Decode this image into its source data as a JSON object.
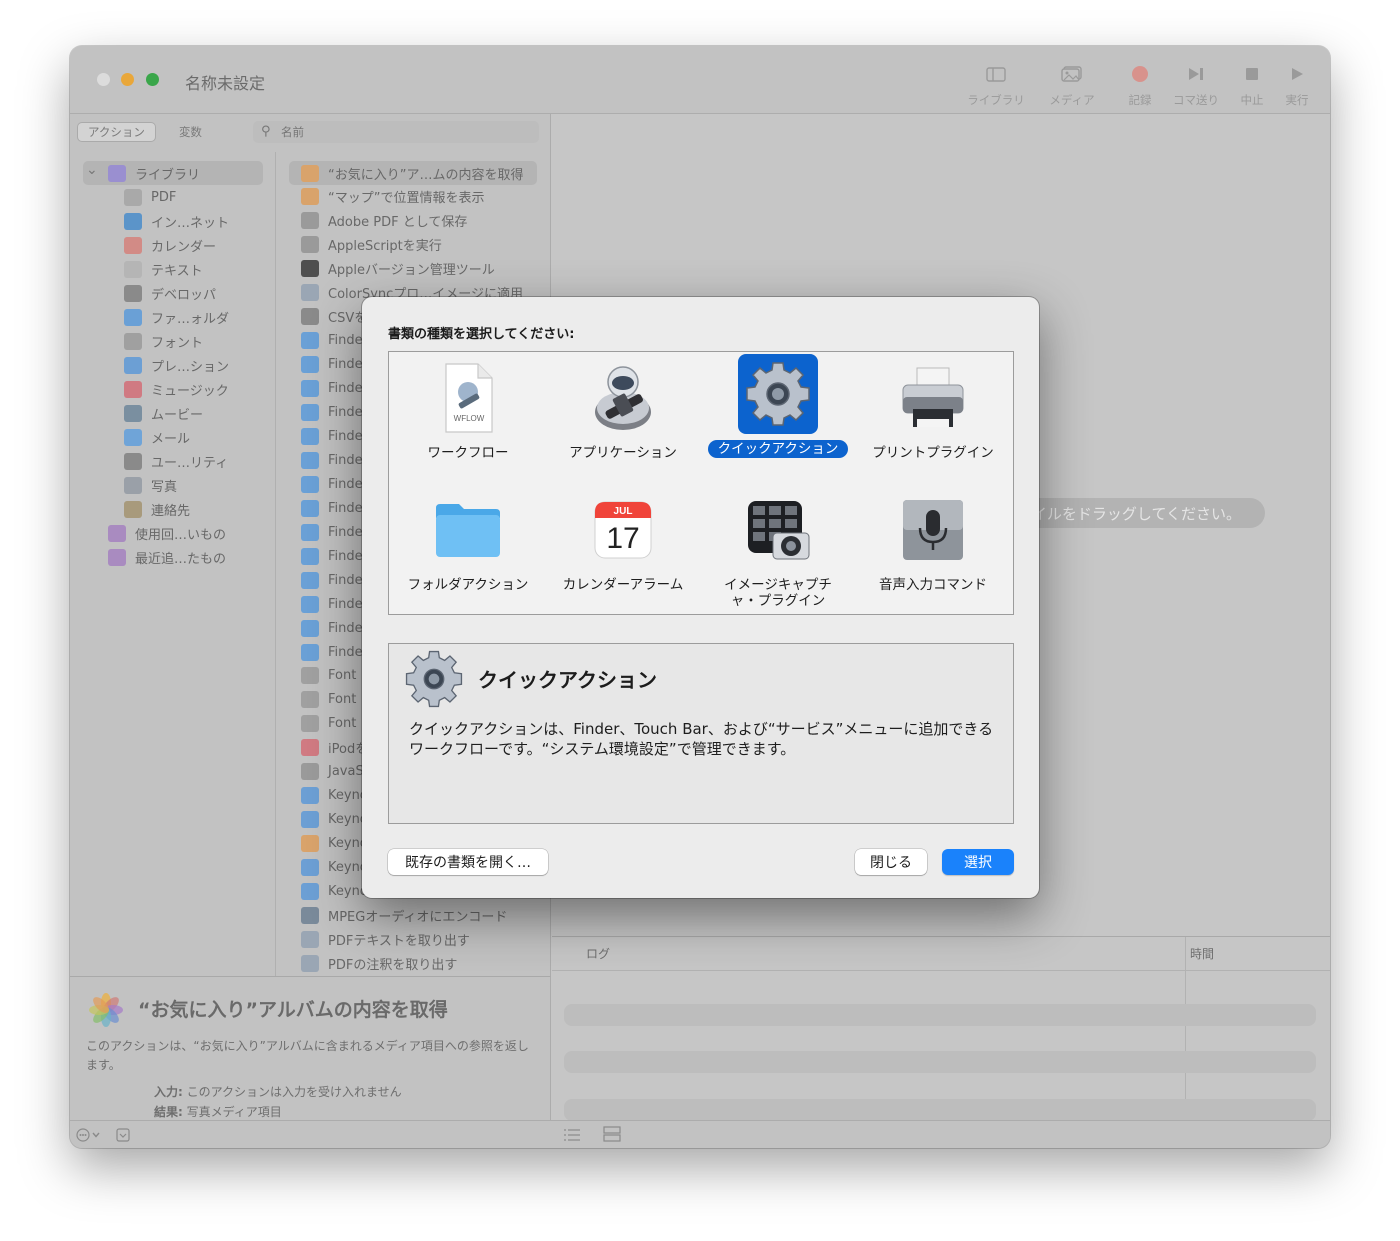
{
  "window": {
    "title": "名称未設定"
  },
  "colors": {
    "accent": "#0c63ce",
    "primary_button": "#1a82fb",
    "close": "#ff5f57",
    "minimize": "#febc2e",
    "zoom": "#28c840"
  },
  "toolbar": {
    "library": "ライブラリ",
    "media": "メディア",
    "record": "記録",
    "step": "コマ送り",
    "stop": "中止",
    "run": "実行"
  },
  "sidebar": {
    "tabs": {
      "actions": "アクション",
      "variables": "変数"
    },
    "search_placeholder": "名前",
    "library": [
      {
        "label": "ライブラリ",
        "icon": "library-icon",
        "color": "#9a8fd0"
      },
      {
        "label": "PDF",
        "icon": "pdf-icon",
        "color": "#a9a9a9"
      },
      {
        "label": "イン…ネット",
        "icon": "globe-icon",
        "color": "#5b94c9"
      },
      {
        "label": "カレンダー",
        "icon": "calendar-icon",
        "color": "#d28b86"
      },
      {
        "label": "テキスト",
        "icon": "text-icon",
        "color": "#b5b5b5"
      },
      {
        "label": "デベロッパ",
        "icon": "tools-icon",
        "color": "#8a8a8a"
      },
      {
        "label": "ファ…ォルダ",
        "icon": "finder-icon",
        "color": "#6aa0d6"
      },
      {
        "label": "フォント",
        "icon": "font-icon",
        "color": "#a0a0a0"
      },
      {
        "label": "プレ…ション",
        "icon": "keynote-icon",
        "color": "#6c9fd4"
      },
      {
        "label": "ミュージック",
        "icon": "music-icon",
        "color": "#d07a82"
      },
      {
        "label": "ムービー",
        "icon": "movie-icon",
        "color": "#7a8fa0"
      },
      {
        "label": "メール",
        "icon": "mail-icon",
        "color": "#6fa4d8"
      },
      {
        "label": "ユー…リティ",
        "icon": "utility-icon",
        "color": "#8a8a8a"
      },
      {
        "label": "写真",
        "icon": "photo-icon",
        "color": "#9aa0a8"
      },
      {
        "label": "連絡先",
        "icon": "contacts-icon",
        "color": "#a89a7c"
      },
      {
        "label": "使用回…いもの",
        "icon": "smart-folder-icon",
        "color": "#a98bc0"
      },
      {
        "label": "最近追…たもの",
        "icon": "smart-folder-icon",
        "color": "#a98bc0"
      }
    ],
    "actions": [
      {
        "label": "“お気に入り”ア…ムの内容を取得",
        "icon": "photos-icon",
        "color": "#d9a36b"
      },
      {
        "label": "“マップ”で位置情報を表示",
        "icon": "photos-icon",
        "color": "#d9a36b"
      },
      {
        "label": "Adobe PDF として保存",
        "icon": "acrobat-icon",
        "color": "#9a9a9a"
      },
      {
        "label": "AppleScriptを実行",
        "icon": "script-icon",
        "color": "#9a9a9a"
      },
      {
        "label": "Appleバージョン管理ツール",
        "icon": "terminal-icon",
        "color": "#4f4f4f"
      },
      {
        "label": "ColorSyncプロ…イメージに適用",
        "icon": "colorsync-icon",
        "color": "#9aa6b4"
      },
      {
        "label": "CSVを",
        "icon": "tools-icon",
        "color": "#8a8a8a"
      },
      {
        "label": "Finde",
        "icon": "finder-icon",
        "color": "#6aa0d6"
      },
      {
        "label": "Finde",
        "icon": "finder-icon",
        "color": "#6aa0d6"
      },
      {
        "label": "Finde",
        "icon": "finder-icon",
        "color": "#6aa0d6"
      },
      {
        "label": "Finde",
        "icon": "finder-icon",
        "color": "#6aa0d6"
      },
      {
        "label": "Finde",
        "icon": "finder-icon",
        "color": "#6aa0d6"
      },
      {
        "label": "Finde",
        "icon": "finder-icon",
        "color": "#6aa0d6"
      },
      {
        "label": "Finde",
        "icon": "finder-icon",
        "color": "#6aa0d6"
      },
      {
        "label": "Finde",
        "icon": "finder-icon",
        "color": "#6aa0d6"
      },
      {
        "label": "Finde",
        "icon": "finder-icon",
        "color": "#6aa0d6"
      },
      {
        "label": "Finde",
        "icon": "finder-icon",
        "color": "#6aa0d6"
      },
      {
        "label": "Finde",
        "icon": "finder-icon",
        "color": "#6aa0d6"
      },
      {
        "label": "Finde",
        "icon": "finder-icon",
        "color": "#6aa0d6"
      },
      {
        "label": "Finde",
        "icon": "finder-icon",
        "color": "#6aa0d6"
      },
      {
        "label": "Finde",
        "icon": "finder-icon",
        "color": "#6aa0d6"
      },
      {
        "label": "Font",
        "icon": "font-icon",
        "color": "#a0a0a0"
      },
      {
        "label": "Font",
        "icon": "font-icon",
        "color": "#a0a0a0"
      },
      {
        "label": "Font",
        "icon": "font-icon",
        "color": "#a0a0a0"
      },
      {
        "label": "iPodを",
        "icon": "music-icon",
        "color": "#d07a82"
      },
      {
        "label": "JavaS",
        "icon": "script-icon",
        "color": "#9a9a9a"
      },
      {
        "label": "Keyno",
        "icon": "keynote-icon",
        "color": "#6c9fd4"
      },
      {
        "label": "Keyno",
        "icon": "keynote-icon",
        "color": "#6c9fd4"
      },
      {
        "label": "Keyno",
        "icon": "photos-icon",
        "color": "#d9a36b"
      },
      {
        "label": "Keyno",
        "icon": "keynote-icon",
        "color": "#6c9fd4"
      },
      {
        "label": "Keyno",
        "icon": "keynote-icon",
        "color": "#6c9fd4"
      },
      {
        "label": "MPEGオーディオにエンコード",
        "icon": "quicktime-icon",
        "color": "#7a8a9a"
      },
      {
        "label": "PDFテキストを取り出す",
        "icon": "preview-icon",
        "color": "#9aa6b4"
      },
      {
        "label": "PDFの注釈を取り出す",
        "icon": "preview-icon",
        "color": "#9aa6b4"
      }
    ]
  },
  "description": {
    "title": "“お気に入り”アルバムの内容を取得",
    "body": "このアクションは、“お気に入り”アルバムに含まれるメディア項目への参照を返します。",
    "input_label": "入力:",
    "input_value": "このアクションは入力を受け入れません",
    "result_label": "結果:",
    "result_value": "写真メディア項目"
  },
  "workflow": {
    "drop_hint": "イルをドラッグしてください。"
  },
  "log": {
    "col_log": "ログ",
    "col_time": "時間"
  },
  "dialog": {
    "prompt": "書類の種類を選択してください:",
    "types": [
      {
        "label": "ワークフロー",
        "icon": "workflow-file-icon",
        "selected": false
      },
      {
        "label": "アプリケーション",
        "icon": "automator-robot-icon",
        "selected": false
      },
      {
        "label": "クイックアクション",
        "icon": "gear-icon",
        "selected": true
      },
      {
        "label": "プリントプラグイン",
        "icon": "printer-icon",
        "selected": false
      },
      {
        "label": "フォルダアクション",
        "icon": "folder-icon",
        "selected": false
      },
      {
        "label": "カレンダーアラーム",
        "icon": "calendar-icon",
        "selected": false
      },
      {
        "label": "イメージキャプチャ・プラグイン",
        "icon": "image-capture-icon",
        "selected": false
      },
      {
        "label": "音声入力コマンド",
        "icon": "microphone-icon",
        "selected": false
      }
    ],
    "file_badge": "WFLOW",
    "calendar_month": "JUL",
    "calendar_day": "17",
    "info_title": "クイックアクション",
    "info_body": "クイックアクションは、Finder、Touch Bar、および“サービス”メニューに追加できるワークフローです。“システム環境設定”で管理できます。",
    "open_existing": "既存の書類を開く…",
    "close": "閉じる",
    "choose": "選択"
  }
}
